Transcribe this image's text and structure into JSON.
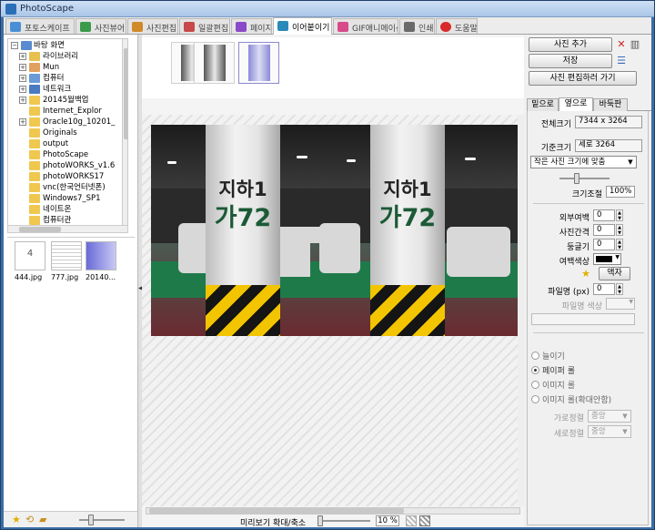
{
  "window": {
    "title": "PhotoScape"
  },
  "tabs": [
    {
      "label": "포토스케이프",
      "color": "#4a8fd6"
    },
    {
      "label": "사진뷰어",
      "color": "#3a9a4a"
    },
    {
      "label": "사진편집",
      "color": "#d08a2a"
    },
    {
      "label": "일괄편집",
      "color": "#c84a4a"
    },
    {
      "label": "페이지",
      "color": "#8a4ac8"
    },
    {
      "label": "이어붙이기",
      "color": "#2a8ab8"
    },
    {
      "label": "GIF애니메이션",
      "color": "#d84a8a"
    },
    {
      "label": "인쇄",
      "color": "#6a6a6a"
    },
    {
      "label": "도움말",
      "color": "#d82a2a"
    }
  ],
  "tree": {
    "root": "바탕 화면",
    "items": [
      {
        "label": "라이브러리",
        "expander": "+",
        "icon": "library-icon"
      },
      {
        "label": "Mun",
        "expander": "+",
        "icon": "user-folder-icon"
      },
      {
        "label": "컴퓨터",
        "expander": "+",
        "icon": "computer-icon"
      },
      {
        "label": "네트워크",
        "expander": "+",
        "icon": "network-icon"
      },
      {
        "label": "20145월백업",
        "expander": "+",
        "icon": "folder-icon"
      },
      {
        "label": "Internet_Explor",
        "expander": "",
        "icon": "folder-icon"
      },
      {
        "label": "Oracle10g_10201_",
        "expander": "+",
        "icon": "folder-icon"
      },
      {
        "label": "Originals",
        "expander": "",
        "icon": "folder-icon"
      },
      {
        "label": "output",
        "expander": "",
        "icon": "folder-icon"
      },
      {
        "label": "PhotoScape",
        "expander": "",
        "icon": "folder-icon"
      },
      {
        "label": "photoWORKS_v1.6",
        "expander": "",
        "icon": "folder-icon"
      },
      {
        "label": "photoWORKS17",
        "expander": "",
        "icon": "folder-icon"
      },
      {
        "label": "vnc(한국언터넷폰)",
        "expander": "",
        "icon": "folder-icon"
      },
      {
        "label": "Windows7_SP1",
        "expander": "",
        "icon": "folder-icon"
      },
      {
        "label": "네이트온",
        "expander": "",
        "icon": "folder-icon"
      },
      {
        "label": "컴퓨터관",
        "expander": "",
        "icon": "folder-icon"
      }
    ]
  },
  "files": [
    {
      "name": "444.jpg",
      "thumb_text": "4"
    },
    {
      "name": "777.jpg",
      "thumb_text": ""
    },
    {
      "name": "20140...",
      "thumb_text": ""
    }
  ],
  "center": {
    "sign_line1": "지하1",
    "sign_line2": "가72",
    "zoom_label": "미리보기 확대/축소",
    "zoom_value": "10 %"
  },
  "right": {
    "add_photo": "사진 추가",
    "save": "저장",
    "goto_edit": "사진 편집하러 가기",
    "tabs": [
      "밑으로",
      "옆으로",
      "바둑판"
    ],
    "total_size_label": "전체크기",
    "total_size_value": "7344 x 3264",
    "base_size_label": "기준크기",
    "base_size_value": "세로 3264",
    "fit_option": "작은 사진 크기에 맞춤",
    "scale_label": "크기조절",
    "scale_value": "100%",
    "outer_margin_label": "외부여백",
    "outer_margin_value": "0",
    "photo_gap_label": "사진간격",
    "photo_gap_value": "0",
    "round_label": "둥글기",
    "round_value": "0",
    "margin_color_label": "여백색상",
    "frame_button": "액자",
    "filename_px_label": "파일명 (px)",
    "filename_px_value": "0",
    "filename_color_label": "파일명 색상",
    "radio_options": [
      "늘이기",
      "페이퍼 롤",
      "이미지 롤",
      "이미지 롤(확대안함)"
    ],
    "halign_label": "가로정렬",
    "halign_value": "중앙",
    "valign_label": "세로정렬",
    "valign_value": "중앙"
  }
}
